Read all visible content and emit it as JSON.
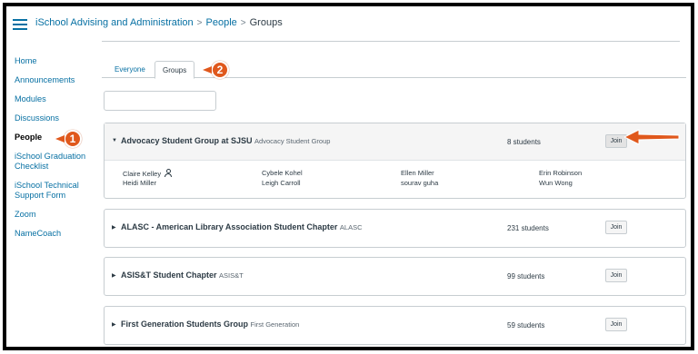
{
  "breadcrumb": {
    "course": "iSchool Advising and Administration",
    "section": "People",
    "current": "Groups",
    "separator": ">"
  },
  "nav": {
    "items": [
      {
        "label": "Home",
        "active": false
      },
      {
        "label": "Announcements",
        "active": false
      },
      {
        "label": "Modules",
        "active": false
      },
      {
        "label": "Discussions",
        "active": false
      },
      {
        "label": "People",
        "active": true
      },
      {
        "label": "iSchool Graduation Checklist",
        "active": false
      },
      {
        "label": "iSchool Technical Support Form",
        "active": false
      },
      {
        "label": "Zoom",
        "active": false
      },
      {
        "label": "NameCoach",
        "active": false
      }
    ]
  },
  "tabs": {
    "everyone": "Everyone",
    "groups": "Groups",
    "active": "groups"
  },
  "search": {
    "value": "",
    "placeholder": ""
  },
  "groups": [
    {
      "name": "Advocacy Student Group at SJSU",
      "category": "Advocacy Student Group",
      "count": "8 students",
      "join_label": "Join",
      "expanded": true,
      "members": [
        "Claire Kelley",
        "Cybele Kohel",
        "Ellen Miller",
        "Erin Robinson",
        "Heidi Miller",
        "Leigh Carroll",
        "sourav guha",
        "Wun Wong"
      ]
    },
    {
      "name": "ALASC - American Library Association Student Chapter",
      "category": "ALASC",
      "count": "231 students",
      "join_label": "Join",
      "expanded": false
    },
    {
      "name": "ASIS&T Student Chapter",
      "category": "ASIS&T",
      "count": "99 students",
      "join_label": "Join",
      "expanded": false
    },
    {
      "name": "First Generation Students Group",
      "category": "First Generation",
      "count": "59 students",
      "join_label": "Join",
      "expanded": false
    }
  ],
  "callouts": {
    "one": "1",
    "two": "2"
  },
  "icons": {
    "menu": "hamburger-icon",
    "caret_open": "caret-down-icon",
    "caret_closed": "caret-right-icon",
    "group_leader": "user-icon"
  },
  "colors": {
    "link": "#0770a3",
    "text": "#2d3b45",
    "border": "#c7cdd1",
    "callout": "#e0581c",
    "expanded_bg": "#f5f5f5"
  }
}
